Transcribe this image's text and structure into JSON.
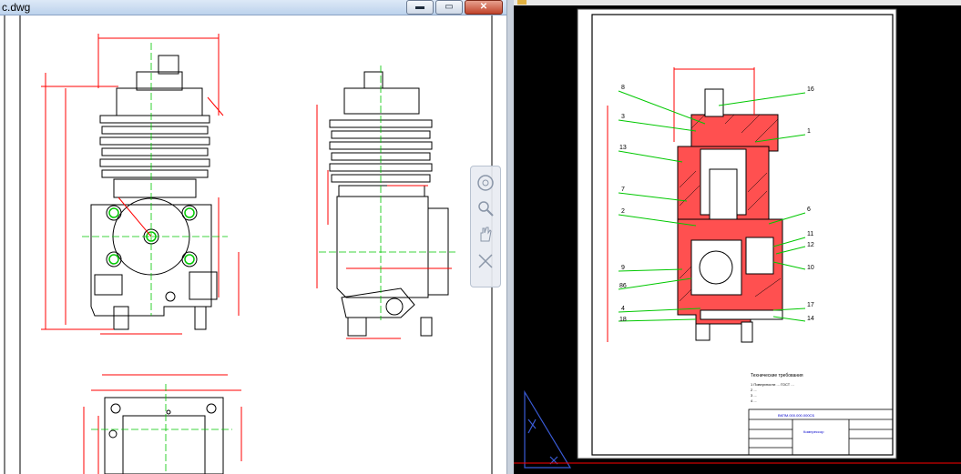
{
  "left_window": {
    "title": "c.dwg",
    "minimize_glyph": "▬",
    "maximize_glyph": "▭",
    "close_glyph": "✕"
  },
  "navigation_bar": {
    "buttons": [
      "steering-wheel-icon",
      "zoom-icon",
      "pan-hand-icon",
      "orbit-icon"
    ]
  },
  "right_drawing": {
    "part_labels_left": [
      "8",
      "3",
      "13",
      "7",
      "2",
      "9",
      "86",
      "4",
      "18"
    ],
    "part_labels_right": [
      "16",
      "1",
      "6",
      "11",
      "12",
      "10",
      "17",
      "14"
    ],
    "notes_heading": "Технические требования",
    "notes": [
      "1 Поверхности ... ГОСТ ...",
      "2 ...",
      "3 ...",
      "4 ..."
    ],
    "stamp_code": "ВКПМ.000.000.000СБ",
    "stamp_title": "Компрессор"
  },
  "colors": {
    "drawing_line": "#000000",
    "dimension": "#ff0000",
    "centerline": "#00c800",
    "section_fill": "#ff4a4a",
    "ucs_icon": "#3a5bd6"
  }
}
